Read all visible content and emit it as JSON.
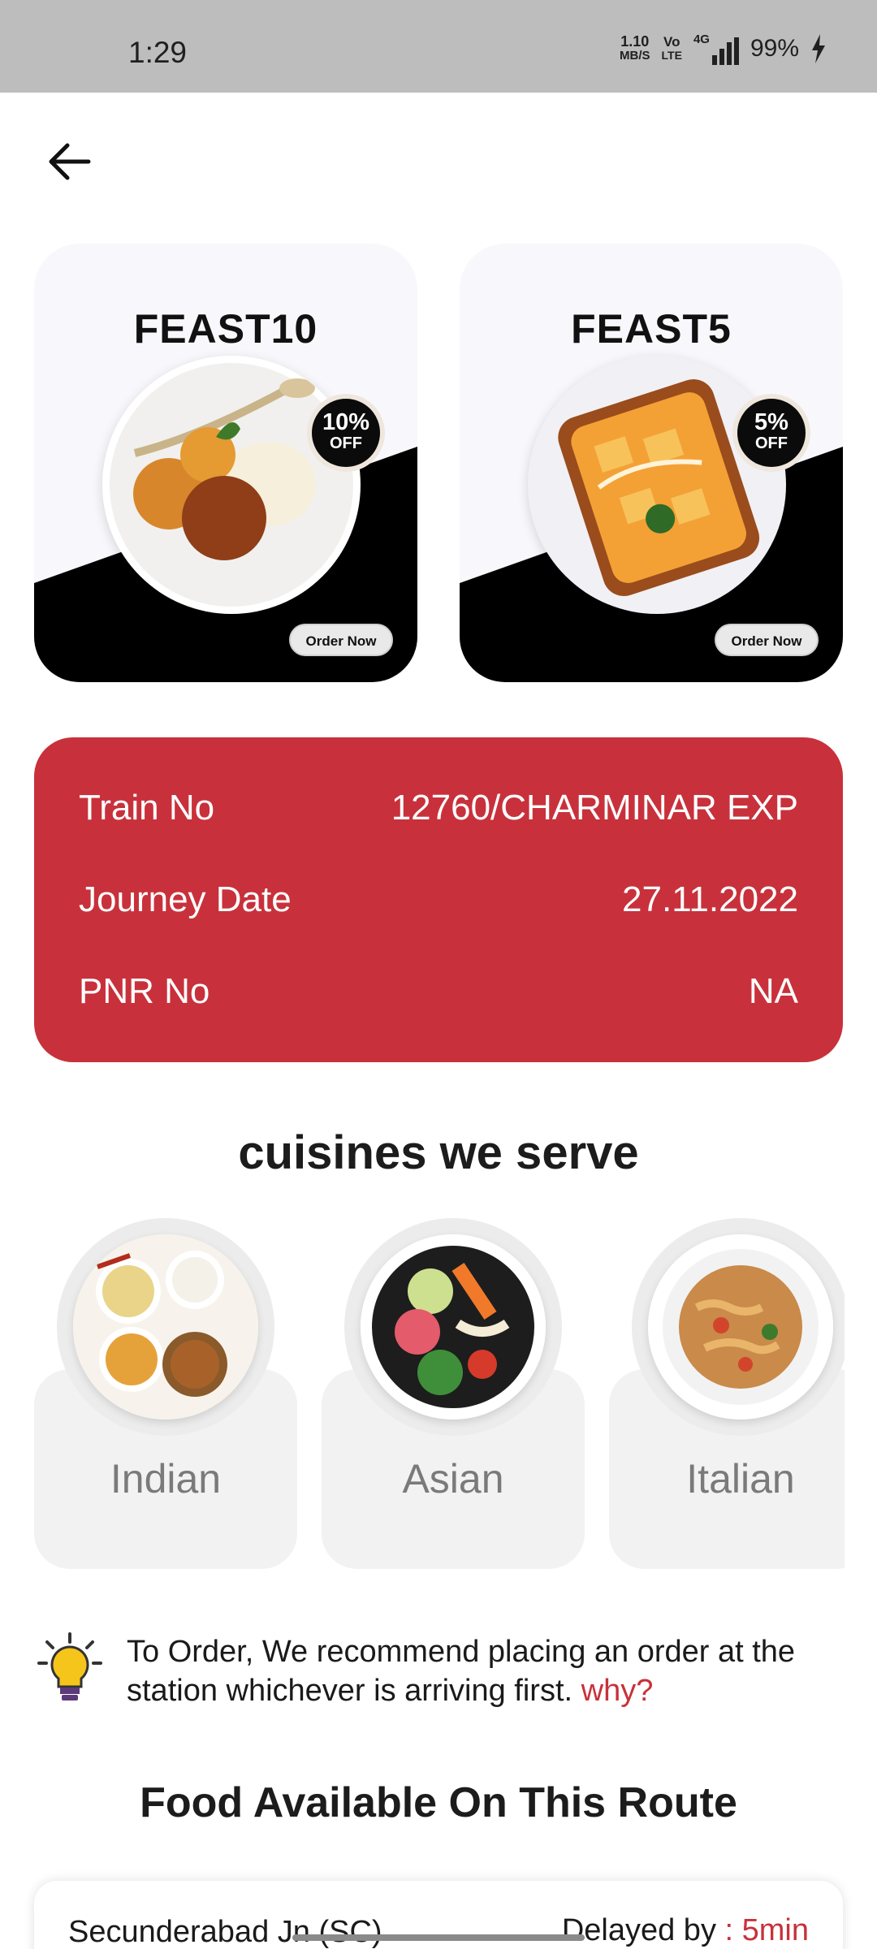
{
  "status_bar": {
    "time": "1:29",
    "net_speed_value": "1.10",
    "net_speed_unit": "MB/S",
    "volte_top": "Vo",
    "volte_bottom": "LTE",
    "network": "4G",
    "battery": "99%"
  },
  "offers": [
    {
      "code": "FEAST10",
      "discount": "10%",
      "off_label": "OFF",
      "button": "Order Now",
      "food_icon": "gulab-jamun-icecream"
    },
    {
      "code": "FEAST5",
      "discount": "5%",
      "off_label": "OFF",
      "button": "Order Now",
      "food_icon": "paneer-curry"
    }
  ],
  "train_info": {
    "rows": [
      {
        "label": "Train No",
        "value": "12760/CHARMINAR EXP"
      },
      {
        "label": "Journey Date",
        "value": "27.11.2022"
      },
      {
        "label": "PNR No",
        "value": "NA"
      }
    ],
    "color": "#c8313b"
  },
  "cuisines": {
    "title": "cuisines we serve",
    "items": [
      {
        "label": "Indian",
        "icon": "indian-thali"
      },
      {
        "label": "Asian",
        "icon": "asian-bowl"
      },
      {
        "label": "Italian",
        "icon": "pasta-plate"
      }
    ]
  },
  "tip": {
    "text": "To Order, We recommend placing an order at the station whichever is arriving first.",
    "link": "why?",
    "icon": "lightbulb-icon"
  },
  "route": {
    "title": "Food Available On This Route",
    "stations": [
      {
        "name": "Secunderabad Jn (SC)",
        "delay_label": "Delayed by",
        "delay_value": ": 5min"
      }
    ]
  }
}
